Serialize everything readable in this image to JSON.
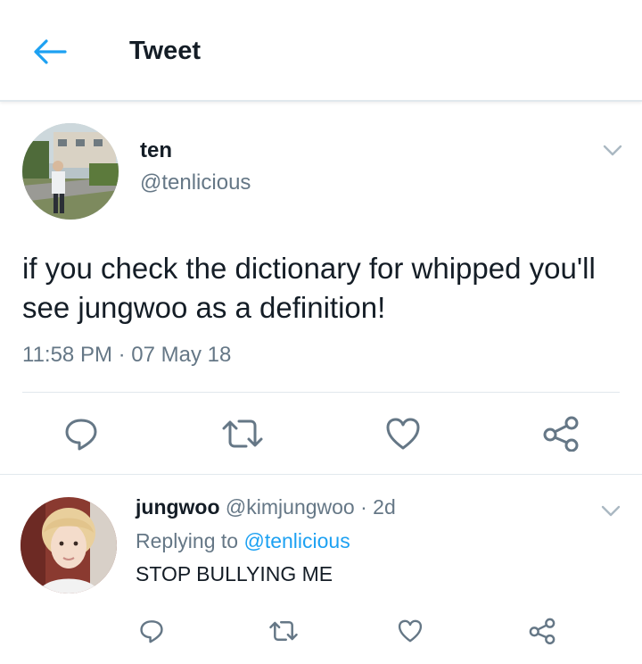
{
  "header": {
    "title": "Tweet"
  },
  "tweet": {
    "name": "ten",
    "handle": "@tenlicious",
    "text": "if you check the dictionary for whipped you'll see jungwoo as a definition!",
    "time": "11:58 PM",
    "separator": "·",
    "date": "07 May 18"
  },
  "reply": {
    "name": "jungwoo",
    "handle": "@kimjungwoo",
    "separator": "·",
    "age": "2d",
    "replying_prefix": "Replying to ",
    "replying_to": "@tenlicious",
    "text": "STOP BULLYING ME"
  },
  "colors": {
    "accent": "#1da1f2",
    "icon_gray": "#657786",
    "text": "#141d26",
    "divider": "#e1e8ed"
  },
  "icons": [
    "back-arrow-icon",
    "chevron-down-icon",
    "reply-icon",
    "retweet-icon",
    "like-icon",
    "share-icon"
  ]
}
